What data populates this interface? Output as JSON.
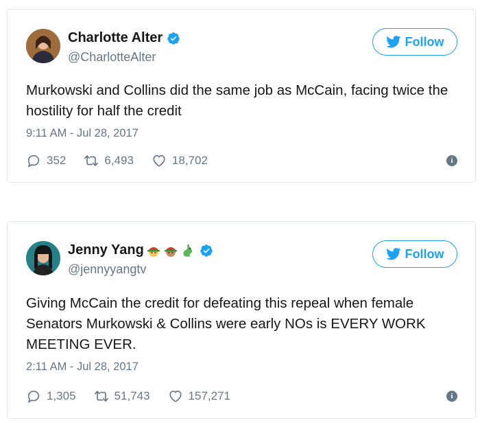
{
  "colors": {
    "accent": "#1da1f2",
    "text": "#14171a",
    "secondary": "#657786",
    "border": "#e1e8ed"
  },
  "tweets": [
    {
      "name": "Charlotte Alter",
      "handle": "@CharlotteAlter",
      "verified": true,
      "follow_label": "Follow",
      "text": "Murkowski and Collins did the same job as McCain, facing twice the hostility for half the credit",
      "timestamp": "9:11 AM - Jul 28, 2017",
      "replies": "352",
      "retweets": "6,493",
      "likes": "18,702",
      "icons": [
        "reply-icon",
        "retweet-icon",
        "heart-icon",
        "info-icon"
      ]
    },
    {
      "name": "Jenny Yang",
      "name_emojis": [
        "person-with-helmet-emoji",
        "person-with-helmet-emoji",
        "dragon-emoji"
      ],
      "handle": "@jennyyangtv",
      "verified": true,
      "follow_label": "Follow",
      "text": "Giving McCain the credit for defeating this repeal when female Senators Murkowski & Collins were early NOs is EVERY WORK MEETING EVER.",
      "timestamp": "2:11 AM - Jul 28, 2017",
      "replies": "1,305",
      "retweets": "51,743",
      "likes": "157,271",
      "icons": [
        "reply-icon",
        "retweet-icon",
        "heart-icon",
        "info-icon"
      ]
    }
  ]
}
